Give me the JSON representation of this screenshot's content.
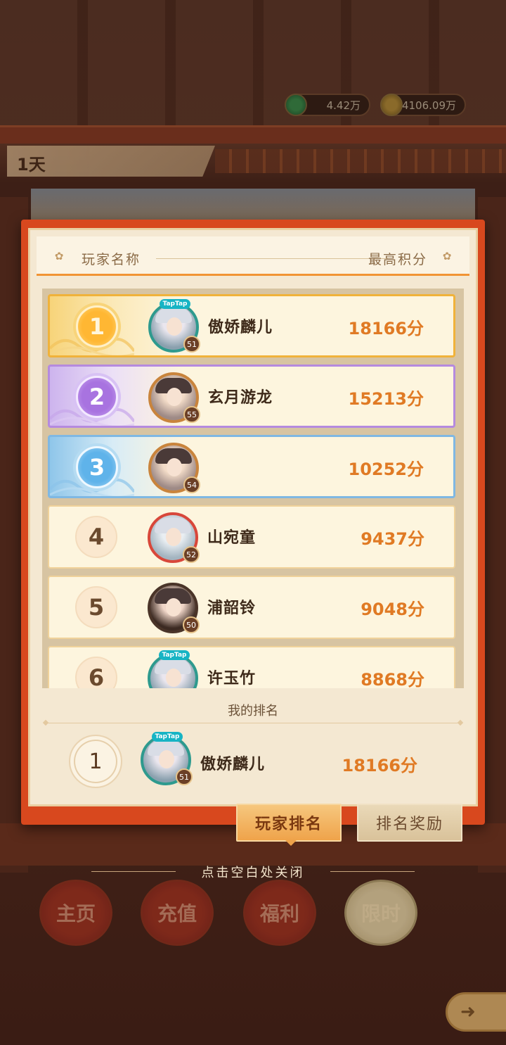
{
  "currency": {
    "jade": "4.42万",
    "gold": "4106.09万"
  },
  "day_tab": "1天",
  "header": {
    "name_col": "玩家名称",
    "score_col": "最高积分"
  },
  "rankings": [
    {
      "rank": "1",
      "name": "傲娇麟儿",
      "score": "18166分",
      "level": "51",
      "tier": "gold",
      "taptap": true
    },
    {
      "rank": "2",
      "name": "玄月游龙",
      "score": "15213分",
      "level": "55",
      "tier": "purple",
      "taptap": false
    },
    {
      "rank": "3",
      "name": "",
      "score": "10252分",
      "level": "54",
      "tier": "blue",
      "taptap": false
    },
    {
      "rank": "4",
      "name": "山宛童",
      "score": "9437分",
      "level": "52",
      "tier": "plain",
      "taptap": false
    },
    {
      "rank": "5",
      "name": "浦韶铃",
      "score": "9048分",
      "level": "50",
      "tier": "plain",
      "taptap": false
    },
    {
      "rank": "6",
      "name": "许玉竹",
      "score": "8868分",
      "level": "",
      "tier": "plain",
      "taptap": true
    }
  ],
  "my_ranking": {
    "title": "我的排名",
    "rank": "1",
    "name": "傲娇麟儿",
    "score": "18166分",
    "level": "51"
  },
  "tabs": {
    "players": "玩家排名",
    "rewards": "排名奖励"
  },
  "close_hint": "点击空白处关闭",
  "bottom_nav": {
    "home": "主页",
    "recharge": "充值",
    "welfare": "福利",
    "limited": "限时"
  },
  "badge_text": "TapTap",
  "colors": {
    "accent": "#e07a24",
    "modal_border": "#d8481e",
    "gold": "#f0b23a",
    "purple": "#b58adf",
    "blue": "#7fb8e3"
  }
}
